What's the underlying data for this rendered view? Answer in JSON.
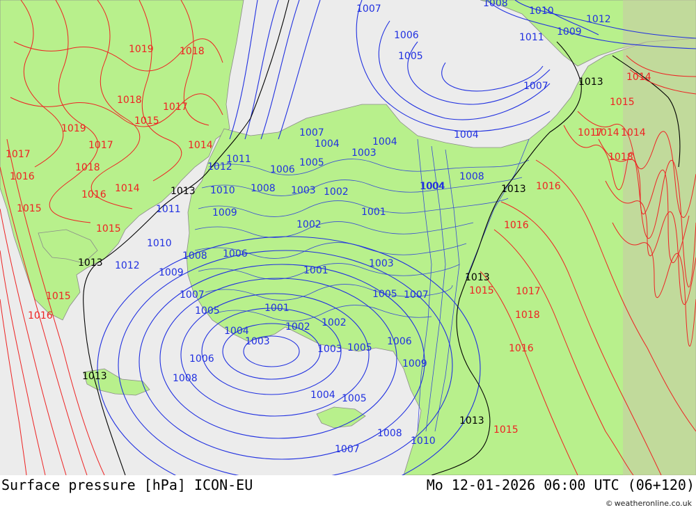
{
  "map": {
    "title": "Surface pressure [hPa] ICON-EU",
    "valid_time": "Mo 12-01-2026 06:00 UTC (06+120)",
    "credit": "weatheronline.co.uk",
    "credit_symbol": "©",
    "colors": {
      "land": "#b8f08c",
      "sea": "#ececec",
      "low_isobar": "#2030e0",
      "mid_isobar": "#000000",
      "high_isobar": "#ee2222",
      "terrain": "#c8c8a8"
    },
    "isobar_labels": [
      {
        "text": "1007",
        "color": "low"
      },
      {
        "text": "1006",
        "color": "low"
      },
      {
        "text": "1005",
        "color": "low"
      },
      {
        "text": "1008",
        "color": "low"
      },
      {
        "text": "1010",
        "color": "low"
      },
      {
        "text": "1012",
        "color": "low"
      },
      {
        "text": "1009",
        "color": "low"
      },
      {
        "text": "1011",
        "color": "low"
      },
      {
        "text": "1007",
        "color": "low"
      },
      {
        "text": "1004",
        "color": "low"
      },
      {
        "text": "1003",
        "color": "low"
      },
      {
        "text": "1002",
        "color": "low"
      },
      {
        "text": "1001",
        "color": "low"
      },
      {
        "text": "1004",
        "color": "low"
      },
      {
        "text": "1008",
        "color": "low"
      },
      {
        "text": "1011",
        "color": "low"
      },
      {
        "text": "1012",
        "color": "low"
      },
      {
        "text": "1010",
        "color": "low"
      },
      {
        "text": "1009",
        "color": "low"
      },
      {
        "text": "1008",
        "color": "low"
      },
      {
        "text": "1007",
        "color": "low"
      },
      {
        "text": "1005",
        "color": "low"
      },
      {
        "text": "1006",
        "color": "low"
      },
      {
        "text": "1004",
        "color": "low"
      },
      {
        "text": "1003",
        "color": "low"
      },
      {
        "text": "1002",
        "color": "low"
      },
      {
        "text": "1004",
        "color": "low"
      },
      {
        "text": "1001",
        "color": "low"
      },
      {
        "text": "1006",
        "color": "low"
      },
      {
        "text": "1008",
        "color": "low"
      },
      {
        "text": "1004",
        "color": "low"
      },
      {
        "text": "1005",
        "color": "low"
      },
      {
        "text": "1006",
        "color": "low"
      },
      {
        "text": "1007",
        "color": "low"
      },
      {
        "text": "1008",
        "color": "low"
      },
      {
        "text": "1010",
        "color": "low"
      },
      {
        "text": "1009",
        "color": "low"
      },
      {
        "text": "1011",
        "color": "low"
      },
      {
        "text": "1012",
        "color": "low"
      },
      {
        "text": "1005",
        "color": "low"
      },
      {
        "text": "1004",
        "color": "low"
      },
      {
        "text": "1002",
        "color": "low"
      },
      {
        "text": "1001",
        "color": "low"
      },
      {
        "text": "1003",
        "color": "low"
      },
      {
        "text": "1003",
        "color": "low"
      },
      {
        "text": "1005",
        "color": "low"
      },
      {
        "text": "1006",
        "color": "low"
      },
      {
        "text": "1007",
        "color": "low"
      },
      {
        "text": "1009",
        "color": "low"
      },
      {
        "text": "1010",
        "color": "low"
      },
      {
        "text": "1008",
        "color": "low"
      },
      {
        "text": "1007",
        "color": "low"
      },
      {
        "text": "1005",
        "color": "low"
      },
      {
        "text": "1004",
        "color": "low"
      },
      {
        "text": "1003",
        "color": "low"
      },
      {
        "text": "1002",
        "color": "low"
      },
      {
        "text": "1013",
        "color": "mid"
      },
      {
        "text": "1013",
        "color": "mid"
      },
      {
        "text": "1013",
        "color": "mid"
      },
      {
        "text": "1013",
        "color": "mid"
      },
      {
        "text": "1013",
        "color": "mid"
      },
      {
        "text": "1013",
        "color": "mid"
      },
      {
        "text": "1013",
        "color": "mid"
      },
      {
        "text": "1019",
        "color": "high"
      },
      {
        "text": "1018",
        "color": "high"
      },
      {
        "text": "1018",
        "color": "high"
      },
      {
        "text": "1017",
        "color": "high"
      },
      {
        "text": "1015",
        "color": "high"
      },
      {
        "text": "1019",
        "color": "high"
      },
      {
        "text": "1017",
        "color": "high"
      },
      {
        "text": "1014",
        "color": "high"
      },
      {
        "text": "1017",
        "color": "high"
      },
      {
        "text": "1018",
        "color": "high"
      },
      {
        "text": "1016",
        "color": "high"
      },
      {
        "text": "1016",
        "color": "high"
      },
      {
        "text": "1014",
        "color": "high"
      },
      {
        "text": "1015",
        "color": "high"
      },
      {
        "text": "1015",
        "color": "high"
      },
      {
        "text": "1014",
        "color": "high"
      },
      {
        "text": "1015",
        "color": "high"
      },
      {
        "text": "1016",
        "color": "high"
      },
      {
        "text": "1016",
        "color": "high"
      },
      {
        "text": "1017",
        "color": "high"
      },
      {
        "text": "1018",
        "color": "high"
      },
      {
        "text": "1016",
        "color": "high"
      },
      {
        "text": "1015",
        "color": "high"
      },
      {
        "text": "1014",
        "color": "high"
      },
      {
        "text": "1015",
        "color": "high"
      },
      {
        "text": "1016",
        "color": "high"
      },
      {
        "text": "1017",
        "color": "high"
      },
      {
        "text": "1018",
        "color": "high"
      },
      {
        "text": "1014",
        "color": "high"
      },
      {
        "text": "1015",
        "color": "high"
      }
    ]
  }
}
